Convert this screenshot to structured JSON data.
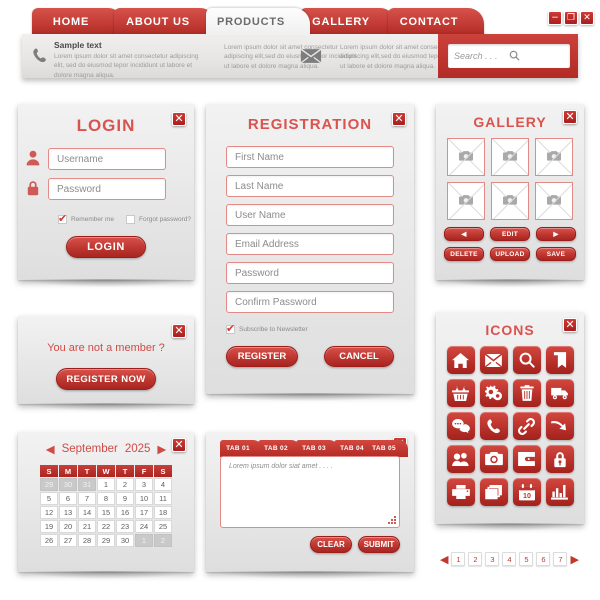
{
  "theme": {
    "red": "#c23b34",
    "red_dark": "#a82521",
    "panel_grey": "#e7e7e7",
    "title_red": "#d9534f"
  },
  "header": {
    "nav": [
      {
        "label": "HOME",
        "active": false
      },
      {
        "label": "ABOUT US",
        "active": false
      },
      {
        "label": "PRODUCTS",
        "active": true
      },
      {
        "label": "GALLERY",
        "active": false
      },
      {
        "label": "CONTACT",
        "active": false
      }
    ],
    "window_buttons": [
      {
        "name": "minimize",
        "glyph": "−"
      },
      {
        "name": "restore",
        "glyph": "❐"
      },
      {
        "name": "close",
        "glyph": "✕"
      }
    ],
    "info_columns": [
      {
        "icon": "phone-icon",
        "heading": "Sample text",
        "body": "Lorem ipsum dolor sit amet consectetur adipiscing elit, sed do eiusmod tepor incididunt ut labore et dolore magna aliqua."
      },
      {
        "icon": "",
        "heading": "",
        "body": "Lorem ipsum dolor sit amet consectetur adipiscing elit,sed do eiusmod tepor incididunt ut labore et dolore magna aliqua."
      },
      {
        "icon": "envelope-icon",
        "heading": "",
        "body": "Lorem ipsum dolor sit amet consectetur adipiscing elit,sed do eiusmod tepor incididunt ut labore et dolore magna aliqua."
      }
    ],
    "search": {
      "placeholder": "Search . . .",
      "value": "",
      "icon": "search-icon"
    }
  },
  "login": {
    "title": "LOGIN",
    "close": "✕",
    "fields": [
      {
        "icon": "user-icon",
        "placeholder": "Username",
        "value": ""
      },
      {
        "icon": "lock-icon",
        "placeholder": "Password",
        "value": ""
      }
    ],
    "checkboxes": [
      {
        "label": "Remember me",
        "checked": true
      },
      {
        "label": "Forgot password?",
        "checked": false
      }
    ],
    "submit_label": "LOGIN"
  },
  "not_member": {
    "close": "✕",
    "message": "You are not a member ?",
    "button_label": "REGISTER NOW"
  },
  "calendar": {
    "close": "✕",
    "prev": "◀",
    "next": "▶",
    "month": "September",
    "year": "2025",
    "weekdays": [
      "S",
      "M",
      "T",
      "W",
      "T",
      "F",
      "S"
    ],
    "weeks": [
      [
        {
          "d": "29",
          "mute": true
        },
        {
          "d": "30",
          "mute": true
        },
        {
          "d": "31",
          "mute": true
        },
        {
          "d": "1",
          "mute": false
        },
        {
          "d": "2",
          "mute": false
        },
        {
          "d": "3",
          "mute": false
        },
        {
          "d": "4",
          "mute": false
        }
      ],
      [
        {
          "d": "5",
          "mute": false
        },
        {
          "d": "6",
          "mute": false
        },
        {
          "d": "7",
          "mute": false
        },
        {
          "d": "8",
          "mute": false
        },
        {
          "d": "9",
          "mute": false
        },
        {
          "d": "10",
          "mute": false
        },
        {
          "d": "11",
          "mute": false
        }
      ],
      [
        {
          "d": "12",
          "mute": false
        },
        {
          "d": "13",
          "mute": false
        },
        {
          "d": "14",
          "mute": false
        },
        {
          "d": "15",
          "mute": false
        },
        {
          "d": "16",
          "mute": false
        },
        {
          "d": "17",
          "mute": false
        },
        {
          "d": "18",
          "mute": false
        }
      ],
      [
        {
          "d": "19",
          "mute": false
        },
        {
          "d": "20",
          "mute": false
        },
        {
          "d": "21",
          "mute": false
        },
        {
          "d": "22",
          "mute": false
        },
        {
          "d": "23",
          "mute": false
        },
        {
          "d": "24",
          "mute": false
        },
        {
          "d": "25",
          "mute": false
        }
      ],
      [
        {
          "d": "26",
          "mute": false
        },
        {
          "d": "27",
          "mute": false
        },
        {
          "d": "28",
          "mute": false
        },
        {
          "d": "29",
          "mute": false
        },
        {
          "d": "30",
          "mute": false
        },
        {
          "d": "1",
          "mute": true
        },
        {
          "d": "2",
          "mute": true
        }
      ]
    ]
  },
  "registration": {
    "title": "REGISTRATION",
    "close": "✕",
    "fields": [
      {
        "placeholder": "First Name",
        "value": ""
      },
      {
        "placeholder": "Last Name",
        "value": ""
      },
      {
        "placeholder": "User Name",
        "value": ""
      },
      {
        "placeholder": "Email Address",
        "value": ""
      },
      {
        "placeholder": "Password",
        "value": ""
      },
      {
        "placeholder": "Confirm Password",
        "value": ""
      }
    ],
    "newsletter": {
      "label": "Subscribe to Newsletter",
      "checked": true
    },
    "submit_label": "REGISTER",
    "cancel_label": "CANCEL"
  },
  "tabs_panel": {
    "close": "✕",
    "tabs": [
      {
        "label": "TAB 01"
      },
      {
        "label": "TAB 02"
      },
      {
        "label": "TAB 03"
      },
      {
        "label": "TAB 04"
      },
      {
        "label": "TAB 05"
      }
    ],
    "textarea": {
      "placeholder": "Lorem ipsum dolor siat amet . . . .",
      "value": ""
    },
    "clear_label": "CLEAR",
    "submit_label": "SUBMIT"
  },
  "gallery": {
    "title": "GALLERY",
    "close": "✕",
    "thumbnails": [
      {
        "icon": "camera-placeholder-icon"
      },
      {
        "icon": "camera-placeholder-icon"
      },
      {
        "icon": "camera-placeholder-icon"
      },
      {
        "icon": "camera-placeholder-icon"
      },
      {
        "icon": "camera-placeholder-icon"
      },
      {
        "icon": "camera-placeholder-icon"
      }
    ],
    "buttons": [
      {
        "label": "◀",
        "name": "prev"
      },
      {
        "label": "EDIT",
        "name": "edit"
      },
      {
        "label": "▶",
        "name": "next"
      },
      {
        "label": "DELETE",
        "name": "delete"
      },
      {
        "label": "UPLOAD",
        "name": "upload"
      },
      {
        "label": "SAVE",
        "name": "save"
      }
    ]
  },
  "icons_panel": {
    "title": "ICONS",
    "close": "✕",
    "icons": [
      "home-icon",
      "envelope-icon",
      "search-icon",
      "bookmark-icon",
      "basket-icon",
      "gears-icon",
      "trash-icon",
      "truck-icon",
      "chat-icon",
      "phone-icon",
      "link-icon",
      "arrow-curve-icon",
      "users-icon",
      "camera-icon",
      "wallet-icon",
      "lock-icon",
      "printer-icon",
      "layers-icon",
      "calendar-icon",
      "chart-icon"
    ],
    "calendar_icon_day": "10"
  },
  "pagination": {
    "prev": "◀",
    "next": "▶",
    "pages": [
      "1",
      "2",
      "3",
      "4",
      "5",
      "6",
      "7"
    ]
  }
}
